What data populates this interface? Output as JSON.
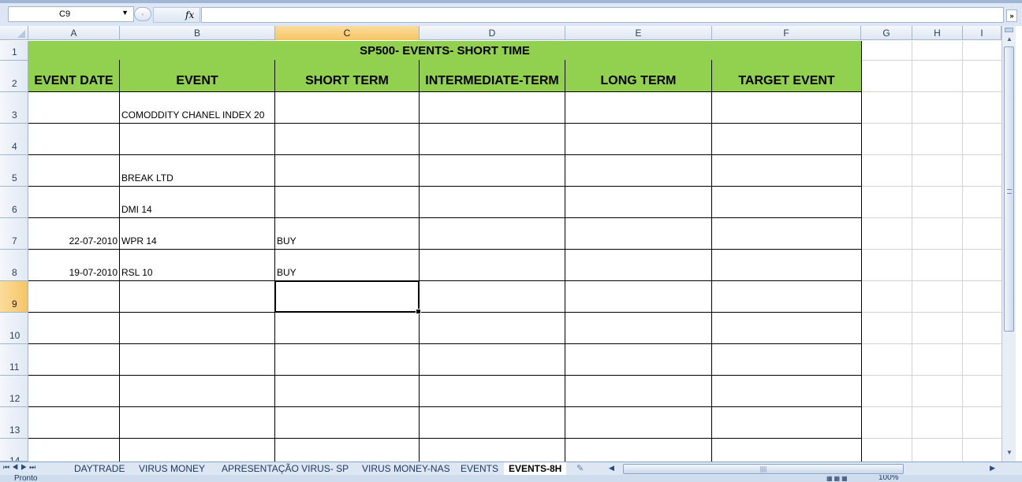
{
  "formula_bar": {
    "name_box": "C9",
    "fx": "fx",
    "formula": ""
  },
  "columns": [
    "A",
    "B",
    "C",
    "D",
    "E",
    "F",
    "G",
    "H",
    "I"
  ],
  "selected_column": "C",
  "rows": [
    "1",
    "2",
    "3",
    "4",
    "5",
    "6",
    "7",
    "8",
    "9",
    "10",
    "11",
    "12",
    "13",
    "14"
  ],
  "selected_row": "9",
  "sheet": {
    "title": "SP500- EVENTS- SHORT TIME",
    "headers": [
      "EVENT DATE",
      "EVENT",
      "SHORT TERM",
      "INTERMEDIATE-TERM",
      "LONG TERM",
      "TARGET EVENT"
    ],
    "cells": {
      "B3": "COMODDITY CHANEL INDEX 20",
      "B5": "BREAK LTD",
      "B6": "DMI 14",
      "A7": "22-07-2010",
      "B7": "WPR 14",
      "C7": "BUY",
      "A8": "19-07-2010",
      "B8": "RSL 10",
      "C8": "BUY"
    },
    "header_fill": "#92d050"
  },
  "tabs": [
    "DAYTRADE",
    "VIRUS MONEY",
    "APRESENTAÇÃO VIRUS- SP",
    "VIRUS MONEY-NAS",
    "EVENTS",
    "EVENTS-8H"
  ],
  "active_tab": "EVENTS-8H",
  "status": {
    "text": "Pronto",
    "zoom": "100%"
  }
}
